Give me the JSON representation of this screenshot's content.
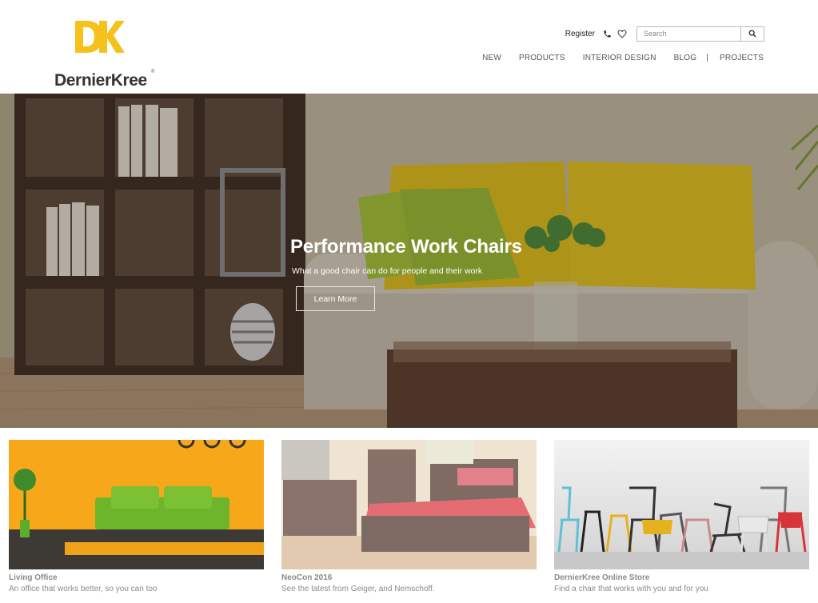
{
  "brand": {
    "monogram": "DK",
    "name": "DernierKree",
    "trademark": "®"
  },
  "header": {
    "register_label": "Register",
    "search_placeholder": "Search",
    "nav": [
      {
        "label": "NEW"
      },
      {
        "label": "PRODUCTS"
      },
      {
        "label": "INTERIOR DESIGN"
      },
      {
        "label": "BLOG"
      },
      {
        "label": "PROJECTS"
      }
    ],
    "nav_separator": "|"
  },
  "hero": {
    "title": "Performance Work Chairs",
    "subtitle": "What a good chair can do for people and their work",
    "button_label": "Learn More"
  },
  "cards": [
    {
      "title": "Living Office",
      "description": "An office that works better, so you can too"
    },
    {
      "title": "NeoCon 2016",
      "description": "See the latest from Geiger, and Nemschoff."
    },
    {
      "title": "DernierKree Online Store",
      "description": "Find a chair that works with you and for you"
    }
  ],
  "colors": {
    "brand_yellow": "#f5c21b",
    "pillow_yellow": "#e7c51c",
    "sofa_green": "#6db52a",
    "card_orange": "#f6a81a",
    "bed_red": "#d9363e"
  },
  "icons": [
    "phone-icon",
    "heart-icon",
    "search-icon"
  ]
}
